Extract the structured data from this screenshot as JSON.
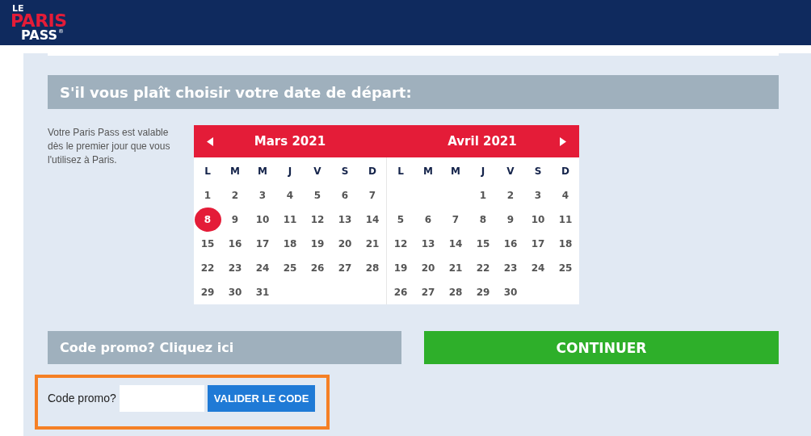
{
  "logo": {
    "line_1": "LE",
    "line_2": "PARIS",
    "line_3": "PASS",
    "mark": "®"
  },
  "heading": "S'il vous plaît choisir votre date de départ:",
  "description": "Votre Paris Pass est valable dès le premier jour que vous l'utilisez à Paris.",
  "calendar": {
    "months": [
      {
        "title": "Mars 2021",
        "weekdays": [
          "L",
          "M",
          "M",
          "J",
          "V",
          "S",
          "D"
        ],
        "weeks": [
          [
            {
              "kind": "day",
              "day": "1",
              "selected": false
            },
            {
              "kind": "day",
              "day": "2",
              "selected": false
            },
            {
              "kind": "day",
              "day": "3",
              "selected": false
            },
            {
              "kind": "day",
              "day": "4",
              "selected": false
            },
            {
              "kind": "day",
              "day": "5",
              "selected": false
            },
            {
              "kind": "day",
              "day": "6",
              "selected": false
            },
            {
              "kind": "day",
              "day": "7",
              "selected": false
            }
          ],
          [
            {
              "kind": "day",
              "day": "8",
              "selected": true
            },
            {
              "kind": "day",
              "day": "9",
              "selected": false
            },
            {
              "kind": "day",
              "day": "10",
              "selected": false
            },
            {
              "kind": "day",
              "day": "11",
              "selected": false
            },
            {
              "kind": "day",
              "day": "12",
              "selected": false
            },
            {
              "kind": "day",
              "day": "13",
              "selected": false
            },
            {
              "kind": "day",
              "day": "14",
              "selected": false
            }
          ],
          [
            {
              "kind": "day",
              "day": "15",
              "selected": false
            },
            {
              "kind": "day",
              "day": "16",
              "selected": false
            },
            {
              "kind": "day",
              "day": "17",
              "selected": false
            },
            {
              "kind": "day",
              "day": "18",
              "selected": false
            },
            {
              "kind": "day",
              "day": "19",
              "selected": false
            },
            {
              "kind": "day",
              "day": "20",
              "selected": false
            },
            {
              "kind": "day",
              "day": "21",
              "selected": false
            }
          ],
          [
            {
              "kind": "day",
              "day": "22",
              "selected": false
            },
            {
              "kind": "day",
              "day": "23",
              "selected": false
            },
            {
              "kind": "day",
              "day": "24",
              "selected": false
            },
            {
              "kind": "day",
              "day": "25",
              "selected": false
            },
            {
              "kind": "day",
              "day": "26",
              "selected": false
            },
            {
              "kind": "day",
              "day": "27",
              "selected": false
            },
            {
              "kind": "day",
              "day": "28",
              "selected": false
            }
          ],
          [
            {
              "kind": "day",
              "day": "29",
              "selected": false
            },
            {
              "kind": "day",
              "day": "30",
              "selected": false
            },
            {
              "kind": "day",
              "day": "31",
              "selected": false
            },
            {
              "kind": "empty"
            },
            {
              "kind": "empty"
            },
            {
              "kind": "empty"
            },
            {
              "kind": "empty"
            }
          ]
        ]
      },
      {
        "title": "Avril 2021",
        "weekdays": [
          "L",
          "M",
          "M",
          "J",
          "V",
          "S",
          "D"
        ],
        "weeks": [
          [
            {
              "kind": "empty"
            },
            {
              "kind": "empty"
            },
            {
              "kind": "empty"
            },
            {
              "kind": "day",
              "day": "1",
              "selected": false
            },
            {
              "kind": "day",
              "day": "2",
              "selected": false
            },
            {
              "kind": "day",
              "day": "3",
              "selected": false
            },
            {
              "kind": "day",
              "day": "4",
              "selected": false
            }
          ],
          [
            {
              "kind": "day",
              "day": "5",
              "selected": false
            },
            {
              "kind": "day",
              "day": "6",
              "selected": false
            },
            {
              "kind": "day",
              "day": "7",
              "selected": false
            },
            {
              "kind": "day",
              "day": "8",
              "selected": false
            },
            {
              "kind": "day",
              "day": "9",
              "selected": false
            },
            {
              "kind": "day",
              "day": "10",
              "selected": false
            },
            {
              "kind": "day",
              "day": "11",
              "selected": false
            }
          ],
          [
            {
              "kind": "day",
              "day": "12",
              "selected": false
            },
            {
              "kind": "day",
              "day": "13",
              "selected": false
            },
            {
              "kind": "day",
              "day": "14",
              "selected": false
            },
            {
              "kind": "day",
              "day": "15",
              "selected": false
            },
            {
              "kind": "day",
              "day": "16",
              "selected": false
            },
            {
              "kind": "day",
              "day": "17",
              "selected": false
            },
            {
              "kind": "day",
              "day": "18",
              "selected": false
            }
          ],
          [
            {
              "kind": "day",
              "day": "19",
              "selected": false
            },
            {
              "kind": "day",
              "day": "20",
              "selected": false
            },
            {
              "kind": "day",
              "day": "21",
              "selected": false
            },
            {
              "kind": "day",
              "day": "22",
              "selected": false
            },
            {
              "kind": "day",
              "day": "23",
              "selected": false
            },
            {
              "kind": "day",
              "day": "24",
              "selected": false
            },
            {
              "kind": "day",
              "day": "25",
              "selected": false
            }
          ],
          [
            {
              "kind": "day",
              "day": "26",
              "selected": false
            },
            {
              "kind": "day",
              "day": "27",
              "selected": false
            },
            {
              "kind": "day",
              "day": "28",
              "selected": false
            },
            {
              "kind": "day",
              "day": "29",
              "selected": false
            },
            {
              "kind": "day",
              "day": "30",
              "selected": false
            },
            {
              "kind": "empty"
            },
            {
              "kind": "empty"
            }
          ]
        ]
      }
    ]
  },
  "promo_toggle": "Code promo? Cliquez ici",
  "continue_button": "CONTINUER",
  "promo_form": {
    "label": "Code promo?",
    "button": "VALIDER LE CODE"
  }
}
